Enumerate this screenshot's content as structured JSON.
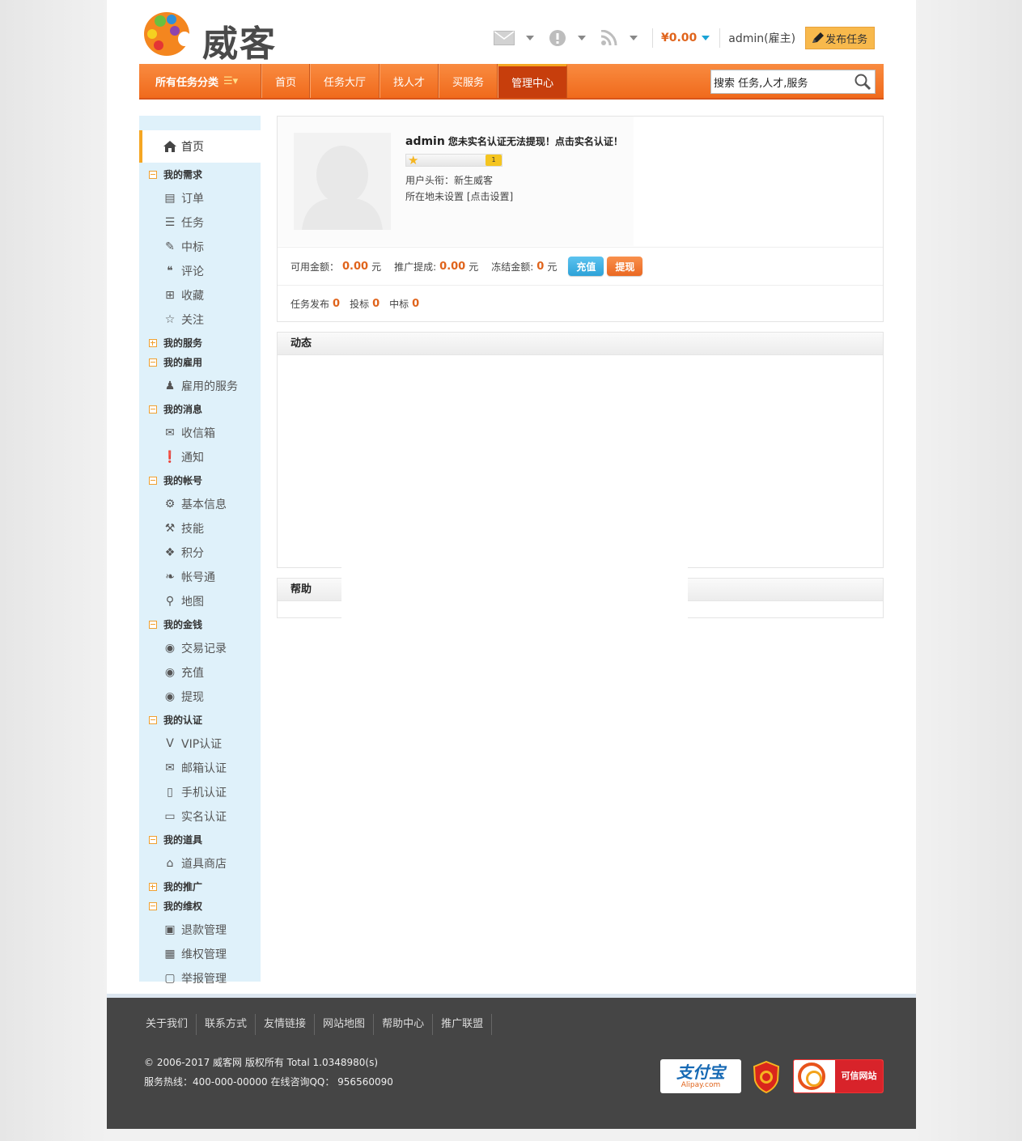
{
  "header": {
    "logo_text": "威客",
    "balance": "¥0.00",
    "user": "admin(雇主)",
    "publish_label": "发布任务"
  },
  "nav": {
    "category": "所有任务分类",
    "items": [
      "首页",
      "任务大厅",
      "找人才",
      "买服务",
      "管理中心"
    ],
    "active_index": 4,
    "search_value": "搜索 任务,人才,服务"
  },
  "sidebar": {
    "home": "首页",
    "groups": [
      {
        "label": "我的需求",
        "expanded": true,
        "items": [
          {
            "label": "订单",
            "icon": "order-icon"
          },
          {
            "label": "任务",
            "icon": "list-icon"
          },
          {
            "label": "中标",
            "icon": "edit-doc-icon"
          },
          {
            "label": "评论",
            "icon": "comments-icon"
          },
          {
            "label": "收藏",
            "icon": "plus-square-icon"
          },
          {
            "label": "关注",
            "icon": "star-icon"
          }
        ]
      },
      {
        "label": "我的服务",
        "expanded": false,
        "items": []
      },
      {
        "label": "我的雇用",
        "expanded": true,
        "items": [
          {
            "label": "雇用的服务",
            "icon": "user-icon"
          }
        ]
      },
      {
        "label": "我的消息",
        "expanded": true,
        "items": [
          {
            "label": "收信箱",
            "icon": "envelope-icon"
          },
          {
            "label": "通知",
            "icon": "exclamation-icon"
          }
        ]
      },
      {
        "label": "我的帐号",
        "expanded": true,
        "items": [
          {
            "label": "基本信息",
            "icon": "gear-icon"
          },
          {
            "label": "技能",
            "icon": "wrench-icon"
          },
          {
            "label": "积分",
            "icon": "gift-icon"
          },
          {
            "label": "帐号通",
            "icon": "leaf-icon"
          },
          {
            "label": "地图",
            "icon": "map-marker-icon"
          }
        ]
      },
      {
        "label": "我的金钱",
        "expanded": true,
        "items": [
          {
            "label": "交易记录",
            "icon": "piggy-icon"
          },
          {
            "label": "充值",
            "icon": "piggy-plus-icon"
          },
          {
            "label": "提现",
            "icon": "piggy-minus-icon"
          }
        ]
      },
      {
        "label": "我的认证",
        "expanded": true,
        "items": [
          {
            "label": "VIP认证",
            "icon": "vip-icon"
          },
          {
            "label": "邮箱认证",
            "icon": "mail-icon"
          },
          {
            "label": "手机认证",
            "icon": "mobile-icon"
          },
          {
            "label": "实名认证",
            "icon": "id-card-icon"
          }
        ]
      },
      {
        "label": "我的道具",
        "expanded": true,
        "items": [
          {
            "label": "道具商店",
            "icon": "shop-icon"
          }
        ]
      },
      {
        "label": "我的推广",
        "expanded": false,
        "items": []
      },
      {
        "label": "我的维权",
        "expanded": true,
        "items": [
          {
            "label": "退款管理",
            "icon": "refund-icon"
          },
          {
            "label": "维权管理",
            "icon": "rights-icon"
          },
          {
            "label": "举报管理",
            "icon": "report-icon"
          }
        ]
      }
    ]
  },
  "profile": {
    "username": "admin",
    "notice": "您未实名认证无法提现！点击实名认证！",
    "level_num": "1",
    "title_label": "用户头衔：新生威客",
    "location_label": "所在地未设置",
    "location_link": "[点击设置]",
    "available_label": "可用金额：",
    "available_value": "0.00",
    "promo_label": "推广提成:",
    "promo_value": "0.00",
    "frozen_label": "冻结金额:",
    "frozen_value": "0",
    "unit": "元",
    "recharge_label": "充值",
    "withdraw_label": "提现",
    "tasks_label": "任务发布",
    "tasks_value": "0",
    "bids_label": "投标",
    "bids_value": "0",
    "wins_label": "中标",
    "wins_value": "0"
  },
  "panels": {
    "activity_title": "动态",
    "help_title": "帮助"
  },
  "footer": {
    "links": [
      "关于我们",
      "联系方式",
      "友情链接",
      "网站地图",
      "帮助中心",
      "推广联盟"
    ],
    "copyright": "© 2006-2017 威客网 版权所有 Total 1.0348980(s)",
    "hotline": "服务热线：400-000-00000 在线咨询QQ： 956560090",
    "alipay_main": "支付宝",
    "alipay_sub": "Alipay.com",
    "trust_label": "可信网站"
  },
  "colors": {
    "nav_orange": "#f06a1c",
    "nav_active": "#c73e0c",
    "sidebar_bg": "#dff1fa",
    "money_orange": "#e0641c",
    "footer_bg": "#454545"
  }
}
